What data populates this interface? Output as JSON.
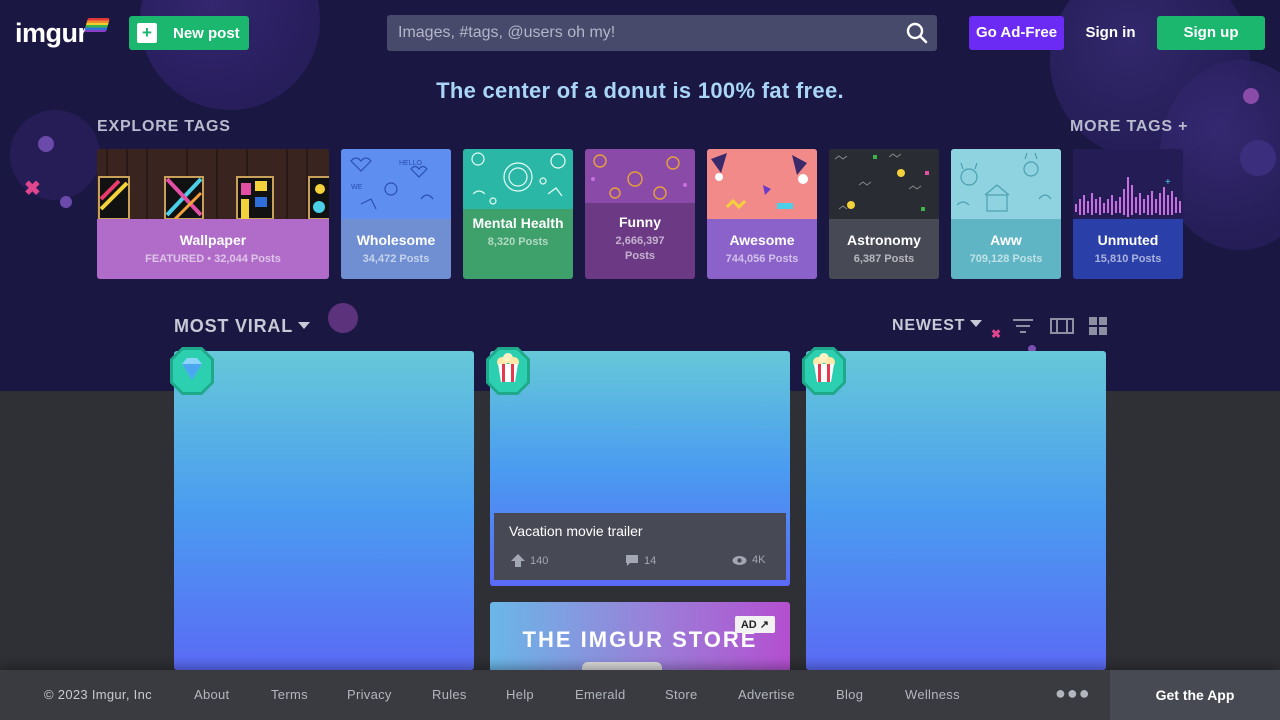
{
  "header": {
    "logo": "imgur",
    "new_post": "New post",
    "search_placeholder": "Images, #tags, @users oh my!",
    "go_ad_free": "Go Ad-Free",
    "sign_in": "Sign in",
    "sign_up": "Sign up"
  },
  "tagline": "The center of a donut is 100% fat free.",
  "explore": {
    "title": "EXPLORE TAGS",
    "more": "MORE TAGS +",
    "tags": [
      {
        "name": "Wallpaper",
        "count": "FEATURED • 32,044 Posts",
        "color": "#b06cc8"
      },
      {
        "name": "Wholesome",
        "count": "34,472 Posts",
        "color": "#6f8fd2"
      },
      {
        "name": "Mental Health",
        "count": "8,320 Posts",
        "color": "#3ea06a"
      },
      {
        "name": "Funny",
        "count": "2,666,397 Posts",
        "color": "#6c3a84"
      },
      {
        "name": "Awesome",
        "count": "744,056 Posts",
        "color": "#8b62c9"
      },
      {
        "name": "Astronomy",
        "count": "6,387 Posts",
        "color": "#474a55"
      },
      {
        "name": "Aww",
        "count": "709,128 Posts",
        "color": "#5fb5c4"
      },
      {
        "name": "Unmuted",
        "count": "15,810 Posts",
        "color": "#2a3fa8"
      }
    ]
  },
  "feed": {
    "sort": "MOST VIRAL",
    "order": "NEWEST",
    "post": {
      "title": "Vacation movie trailer",
      "upvotes": "140",
      "comments": "14",
      "views": "4K"
    },
    "ad": {
      "title": "THE IMGUR STORE",
      "label": "AD"
    }
  },
  "footer": {
    "copyright": "© 2023 Imgur, Inc",
    "links": [
      "About",
      "Terms",
      "Privacy",
      "Rules",
      "Help",
      "Emerald",
      "Store",
      "Advertise",
      "Blog",
      "Wellness"
    ],
    "get_app": "Get the App"
  }
}
